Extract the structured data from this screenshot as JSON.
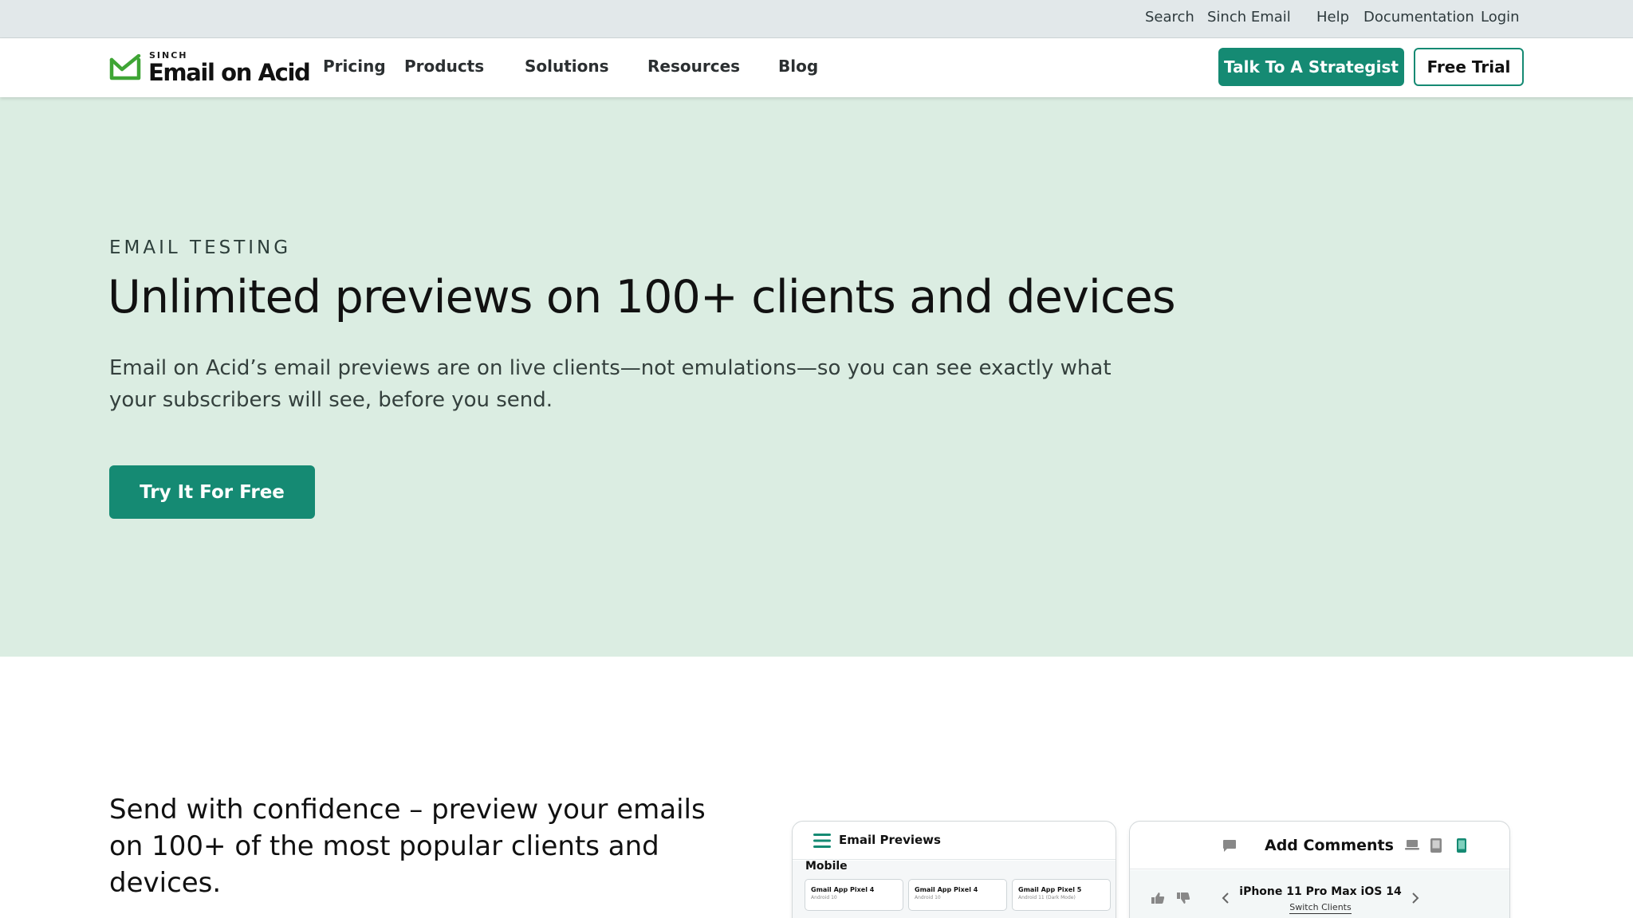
{
  "utility_bar": {
    "links": [
      "Search",
      "Sinch Email",
      "Help",
      "Documentation",
      "Login"
    ]
  },
  "nav": {
    "logo": {
      "eyebrow": "SINCH",
      "name": "Email on Acid"
    },
    "items": [
      "Pricing",
      "Products",
      "Solutions",
      "Resources",
      "Blog"
    ],
    "cta_primary": "Talk To A Strategist",
    "cta_secondary": "Free Trial"
  },
  "hero": {
    "eyebrow": "EMAIL TESTING",
    "title": "Unlimited previews on 100+ clients and devices",
    "subtitle": "Email on Acid’s email previews are on live clients—not emulations—so you can see exactly what your subscribers will see, before you send.",
    "cta": "Try It For Free"
  },
  "feature": {
    "heading": "Send with confidence – preview your emails on 100+ of the most popular clients and devices."
  },
  "previews_panel": {
    "title": "Email Previews",
    "section_label": "Mobile",
    "cards": [
      {
        "name": "Gmail App Pixel 4",
        "os": "Android 10"
      },
      {
        "name": "Gmail App Pixel 4",
        "os": "Android 10"
      },
      {
        "name": "Gmail App Pixel 5",
        "os": "Android 11 (Dark Mode)"
      }
    ]
  },
  "comments_panel": {
    "title": "Add Comments",
    "device": "iPhone 11 Pro Max iOS 14",
    "switch_label": "Switch Clients"
  },
  "colors": {
    "brand_green": "#158a73",
    "hero_background": "#dbede2",
    "utility_background": "#e2e8ea"
  },
  "icons": [
    "check-envelope-logo-icon",
    "menu-icon",
    "comment-icon",
    "laptop-icon",
    "tablet-icon",
    "phone-icon",
    "thumbs-up-icon",
    "thumbs-down-icon",
    "chevron-left-icon",
    "chevron-right-icon"
  ]
}
